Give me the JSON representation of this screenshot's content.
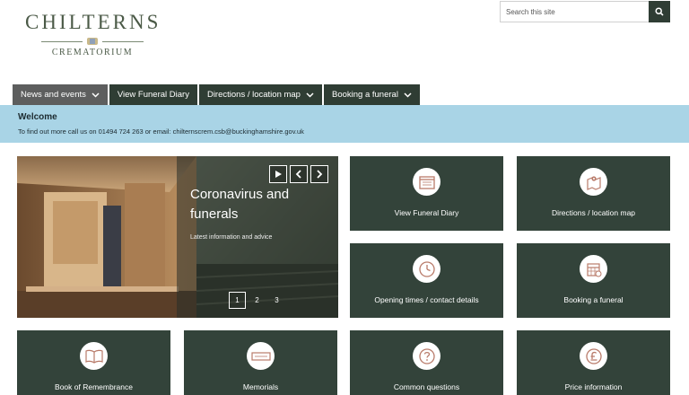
{
  "logo": {
    "title": "CHILTERNS",
    "subtitle": "CREMATORIUM"
  },
  "search": {
    "placeholder": "Search this site",
    "icon": "search-icon"
  },
  "nav": {
    "items": [
      {
        "label": "News and events",
        "dropdown": true
      },
      {
        "label": "View Funeral Diary",
        "dropdown": false
      },
      {
        "label": "Directions / location map",
        "dropdown": true
      },
      {
        "label": "Booking a funeral",
        "dropdown": true
      }
    ]
  },
  "welcome": {
    "title": "Welcome",
    "text": "To find out more call us on 01494 724 263 or email: chilternscrem.csb@buckinghamshire.gov.uk"
  },
  "hero": {
    "title": "Coronavirus and funerals",
    "subtitle": "Latest information and advice",
    "pages": [
      "1",
      "2",
      "3"
    ],
    "active_page": "1"
  },
  "tiles": [
    {
      "label": "View Funeral Diary",
      "icon": "diary-icon"
    },
    {
      "label": "Directions / location map",
      "icon": "map-icon"
    },
    {
      "label": "Opening times / contact details",
      "icon": "clock-icon"
    },
    {
      "label": "Booking a funeral",
      "icon": "calendar-icon"
    },
    {
      "label": "Book of Remembrance",
      "icon": "book-icon"
    },
    {
      "label": "Memorials",
      "icon": "plaque-icon"
    },
    {
      "label": "Common questions",
      "icon": "question-icon"
    },
    {
      "label": "Price information",
      "icon": "pound-icon"
    }
  ],
  "colors": {
    "nav_bg": "#2f3d34",
    "nav_active_bg": "#5d5e5e",
    "welcome_bg": "#a9d4e6",
    "tile_bg": "#33433a",
    "icon_accent": "#b97b6a"
  }
}
